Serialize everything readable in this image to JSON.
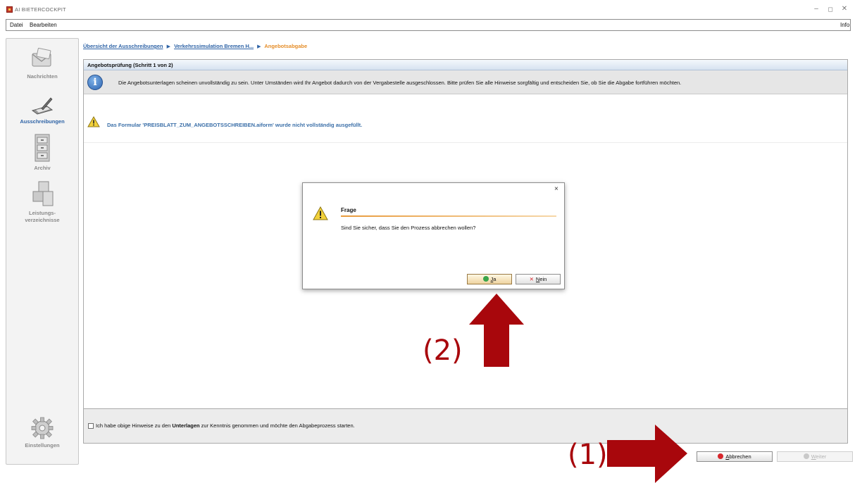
{
  "app": {
    "title": "AI BIETERCOCKPIT"
  },
  "window_controls": {
    "minimize": "–",
    "restore": "◻",
    "close": "✕"
  },
  "menu": {
    "items": [
      "Datei",
      "Bearbeiten"
    ],
    "right_item": "Info"
  },
  "sidebar": {
    "items": [
      {
        "label": "Nachrichten",
        "icon": "mail-icon",
        "active": false
      },
      {
        "label": "Ausschreibungen",
        "icon": "pen-tablet-icon",
        "active": true
      },
      {
        "label": "Archiv",
        "icon": "cabinet-icon",
        "active": false
      },
      {
        "label": "Leistungs-\nverzeichnisse",
        "label_line1": "Leistungs-",
        "label_line2": "verzeichnisse",
        "icon": "boxes-icon",
        "active": false
      }
    ],
    "bottom_item": {
      "label": "Einstellungen",
      "icon": "gear-icon"
    }
  },
  "breadcrumb": {
    "links": [
      "Übersicht der Ausschreibungen",
      "Verkehrssimulation Bremen H..."
    ],
    "current": "Angebotsabgabe"
  },
  "panel": {
    "header": "Angebotsprüfung (Schritt 1 von 2)",
    "info_message": "Die Angebotsunterlagen scheinen unvollständig zu sein. Unter Umständen wird Ihr Angebot dadurch von der Vergabestelle ausgeschlossen. Bitte prüfen Sie alle Hinweise sorgfältig und entscheiden Sie, ob Sie die Abgabe fortführen möchten.",
    "warning": "Das Formular 'PREISBLATT_ZUM_ANGEBOTSSCHREIBEN.aiform' wurde nicht vollständig ausgefüllt."
  },
  "confirm": {
    "text_before": "Ich habe obige Hinweise zu den ",
    "text_bold": "Unterlagen",
    "text_after": " zur Kenntnis genommen und möchte den Abgabeprozess starten.",
    "checked": false
  },
  "buttons": {
    "cancel": {
      "label": "Abbrechen",
      "underline": "A",
      "rest": "bbrechen"
    },
    "next": {
      "label": "Weiter",
      "underline": "W",
      "rest": "eiter",
      "enabled": false
    }
  },
  "dialog": {
    "close_symbol": "×",
    "title": "Frage",
    "message": "Sind Sie sicher, dass Sie den Prozess abbrechen wollen?",
    "yes": {
      "label": "Ja",
      "underline": "J",
      "rest": "a"
    },
    "no": {
      "label": "Nein",
      "underline": "N",
      "rest": "ein"
    }
  },
  "annotations": [
    {
      "label": "(1)",
      "target": "cancel-button"
    },
    {
      "label": "(2)",
      "target": "yes-button"
    }
  ],
  "colors": {
    "accent_blue": "#2e63a6",
    "breadcrumb_current": "#e58e2a",
    "annotation_red": "#a8070c",
    "warning_yellow": "#f2d13a"
  }
}
